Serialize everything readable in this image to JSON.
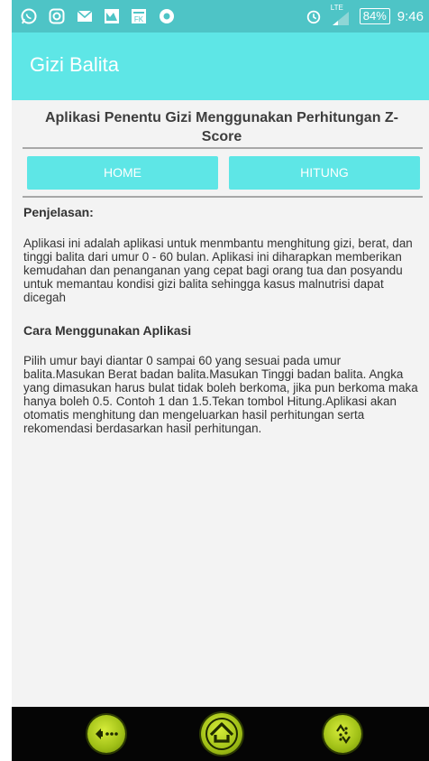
{
  "status_bar": {
    "network": "LTE",
    "battery": "84%",
    "time": "9:46"
  },
  "app_bar": {
    "title": "Gizi Balita"
  },
  "subtitle": "Aplikasi Penentu Gizi Menggunakan Perhitungan Z-Score",
  "tabs": [
    {
      "label": "HOME"
    },
    {
      "label": "HITUNG"
    }
  ],
  "content": {
    "heading1": "Penjelasan:",
    "para1": "Aplikasi ini adalah aplikasi untuk menmbantu menghitung gizi, berat, dan tinggi balita dari umur 0 - 60 bulan. Aplikasi ini diharapkan memberikan kemudahan dan penanganan yang cepat bagi orang tua dan posyandu untuk memantau kondisi gizi balita sehingga kasus malnutrisi dapat dicegah",
    "heading2": "Cara Menggunakan Aplikasi",
    "para2": "Pilih umur bayi diantar 0 sampai 60 yang sesuai pada umur balita.Masukan Berat badan balita.Masukan Tinggi badan balita. Angka yang dimasukan harus bulat tidak boleh berkoma, jika pun berkoma maka hanya boleh 0.5. Contoh 1 dan 1.5.Tekan tombol Hitung.Aplikasi akan otomatis menghitung dan mengeluarkan hasil perhitungan serta rekomendasi berdasarkan hasil perhitungan."
  },
  "colors": {
    "status_bar": "#4ec4c6",
    "accent": "#5ee6e6",
    "nav_button": "#b5d41f"
  },
  "icons": [
    "whatsapp-icon",
    "instagram-icon",
    "mail-icon",
    "gallery-icon",
    "fk-app-icon",
    "chrome-icon",
    "alarm-icon",
    "signal-icon",
    "battery-icon",
    "back-icon",
    "home-icon",
    "recents-icon"
  ]
}
